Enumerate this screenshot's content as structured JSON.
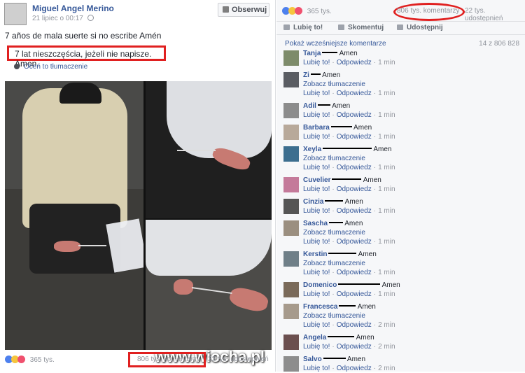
{
  "post": {
    "author": "Miguel Angel Merino",
    "date": "21 lipiec o 00:17",
    "follow_label": "Obserwuj",
    "text_original": "7 años de mala suerte si no escribe Amén",
    "text_translated": "7 lat nieszczęścia, jeżeli nie napisze. Amen.",
    "rate_translation": "Oceń to tłumaczenie",
    "reactions_count": "365 tys.",
    "comments_count": "806 tys. komentarzy",
    "shares_count": "22 tys. udostępnień",
    "watermark": "www.wiocha.pl"
  },
  "panel": {
    "reactions_count": "365 tys.",
    "comments_count": "806 tys. komentarzy",
    "shares_count": "22 tys. udostępnień",
    "actions": {
      "like": "Lubię to!",
      "comment": "Skomentuj",
      "share": "Udostępnij"
    },
    "previous_comments": "Pokaż wcześniejsze komentarze",
    "comment_counter": "14 z 806 828",
    "like_label": "Lubię to!",
    "reply_label": "Odpowiedz",
    "see_translation": "Zobacz tłumaczenie",
    "comments": [
      {
        "name": "Tanja",
        "text": "Amen",
        "time": "1 min",
        "translation": false
      },
      {
        "name": "Zi",
        "text": "Amen",
        "time": "1 min",
        "translation": true
      },
      {
        "name": "Adil",
        "text": "Amen",
        "time": "1 min",
        "translation": false
      },
      {
        "name": "Barbara",
        "text": "Amen",
        "time": "1 min",
        "translation": false
      },
      {
        "name": "Xeyla",
        "text": "Amen",
        "time": "1 min",
        "translation": true
      },
      {
        "name": "Cuvelier",
        "text": "Amen",
        "time": "1 min",
        "translation": false
      },
      {
        "name": "Cinzia",
        "text": "Amen",
        "time": "1 min",
        "translation": false
      },
      {
        "name": "Sascha",
        "text": "Amen",
        "time": "1 min",
        "translation": true
      },
      {
        "name": "Kerstin",
        "text": "Amen",
        "time": "1 min",
        "translation": true
      },
      {
        "name": "Domenico",
        "text": "Amen",
        "time": "1 min",
        "translation": false
      },
      {
        "name": "Francesca",
        "text": "Amen",
        "time": "2 min",
        "translation": true
      },
      {
        "name": "Angela",
        "text": "Amen",
        "time": "2 min",
        "translation": false
      },
      {
        "name": "Salvo",
        "text": "Amen",
        "time": "2 min",
        "translation": false
      }
    ]
  },
  "colors": {
    "link": "#365899",
    "highlight": "#e02020",
    "panel_bg": "#f6f7f9"
  }
}
